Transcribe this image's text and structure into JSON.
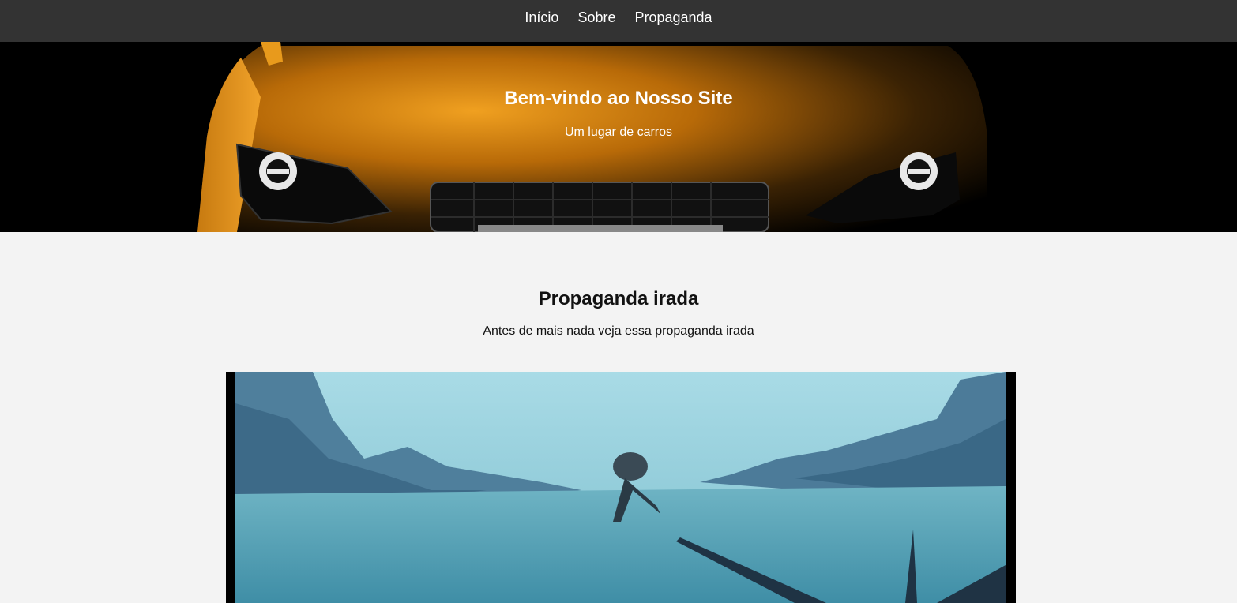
{
  "nav": {
    "items": [
      {
        "label": "Início"
      },
      {
        "label": "Sobre"
      },
      {
        "label": "Propaganda"
      }
    ]
  },
  "hero": {
    "title": "Bem-vindo ao Nosso Site",
    "subtitle": "Um lugar de carros"
  },
  "ad_section": {
    "title": "Propaganda irada",
    "text": "Antes de mais nada veja essa propaganda irada"
  },
  "colors": {
    "nav_bg": "#333333",
    "page_bg": "#f3f3f3",
    "car_orange": "#e08a10",
    "video_sky": "#9fd3de"
  }
}
